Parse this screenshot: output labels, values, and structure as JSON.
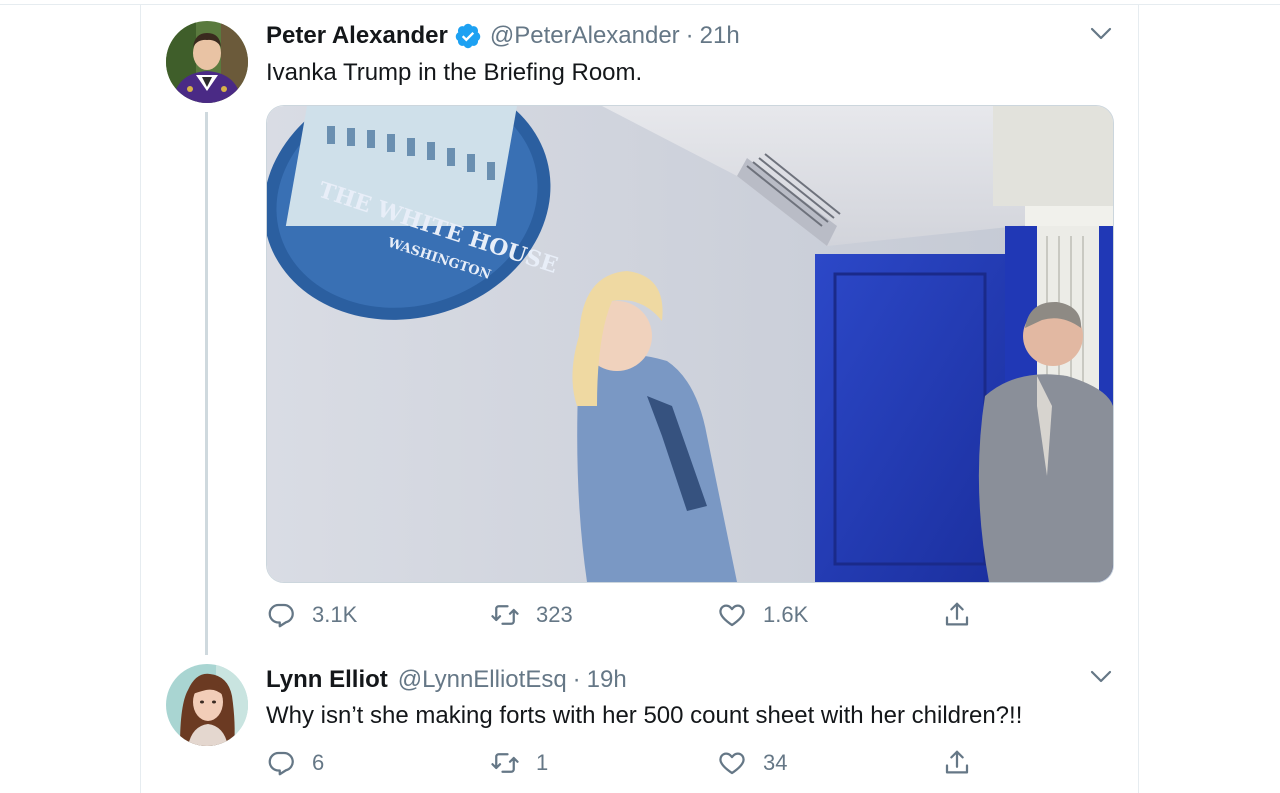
{
  "tweets": [
    {
      "name": "Peter Alexander",
      "verified": true,
      "handle": "@PeterAlexander",
      "separator": "·",
      "time": "21h",
      "text": "Ivanka Trump in the Briefing Room.",
      "photo": {
        "seal_line1": "THE WHITE HOUSE",
        "seal_line2": "WASHINGTON"
      },
      "stats": {
        "replies": "3.1K",
        "retweets": "323",
        "likes": "1.6K"
      }
    },
    {
      "name": "Lynn Elliot",
      "verified": false,
      "handle": "@LynnElliotEsq",
      "separator": "·",
      "time": "19h",
      "text": "Why isn’t she making forts with her 500 count sheet with her children?!!",
      "stats": {
        "replies": "6",
        "retweets": "1",
        "likes": "34"
      }
    }
  ],
  "icons": {
    "reply": "reply-icon",
    "retweet": "retweet-icon",
    "like": "heart-icon",
    "share": "share-icon",
    "caret": "chevron-down-icon",
    "verified": "verified-badge-icon"
  },
  "colors": {
    "text": "#14171a",
    "secondary": "#657786",
    "verified_blue": "#1da1f2",
    "divider": "#e6ecf0"
  }
}
